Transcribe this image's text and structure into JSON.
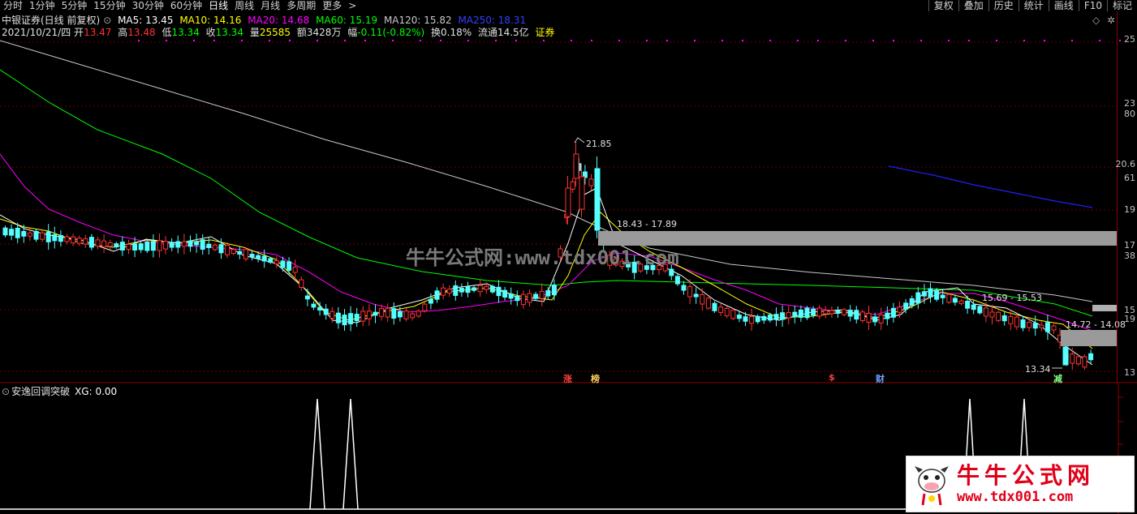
{
  "toolbar": {
    "tabs": [
      "分时",
      "1分钟",
      "5分钟",
      "15分钟",
      "30分钟",
      "60分钟",
      "日线",
      "周线",
      "月线",
      "多周期",
      "更多"
    ],
    "more_arrow": ">",
    "right_buttons": [
      "复权",
      "叠加",
      "历史",
      "统计",
      "画线",
      "F10",
      "标记"
    ]
  },
  "header": {
    "stock_name": "中银证券(日线 前复权)",
    "ma5": "MA5: 13.45",
    "ma10": "MA10: 14.16",
    "ma20": "MA20: 14.68",
    "ma60": "MA60: 15.19",
    "ma120": "MA120: 15.82",
    "ma250": "MA250: 18.31",
    "date": "2021/10/21/四",
    "open_label": "开",
    "open": "13.47",
    "high_label": "高",
    "high": "13.48",
    "low_label": "低",
    "low": "13.34",
    "close_label": "收",
    "close": "13.34",
    "vol_label": "量",
    "vol": "25585",
    "amt_label": "额",
    "amt": "3428万",
    "chg_label": "幅",
    "chg": "-0.11(-0.82%)",
    "turnover": "换0.18%",
    "float": "流通14.5亿",
    "sector": "证券"
  },
  "annotations": {
    "peak": "21.85",
    "range1": "18.43 - 17.89",
    "range2": "15.69 - 15.53",
    "range3": "14.72 - 14.08",
    "low": "13.34"
  },
  "signals": {
    "zhang": "涨",
    "bang": "榜",
    "dollar": "$",
    "cai": "财",
    "jian": "减"
  },
  "price_axis_labels": [
    "25",
    "23",
    "80",
    "20.6",
    "61",
    "19",
    "17",
    "38",
    "15",
    "19",
    "13"
  ],
  "sub_indicator": {
    "name": "安逸回调突破",
    "xg": "XG: 0.00"
  },
  "watermark": "牛牛公式网:www.tdx001.com",
  "logo": {
    "title": "牛牛公式网",
    "url": "www.tdx001.com"
  },
  "colors": {
    "up": "#ff3232",
    "down": "#54ffff",
    "ma5": "#ffffff",
    "ma10": "#ffff00",
    "ma20": "#ff00ff",
    "ma60": "#00ff00",
    "ma120": "#c8c8c8",
    "ma250": "#2020ff"
  }
}
